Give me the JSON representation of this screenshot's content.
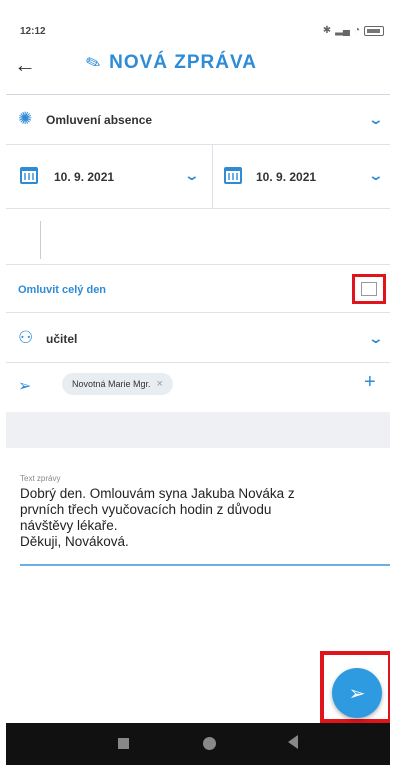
{
  "status": {
    "time": "12:12",
    "icons": [
      "bluetooth-icon",
      "signal-icon",
      "wifi-icon",
      "battery-icon"
    ]
  },
  "header": {
    "back_icon": "arrow-left-icon",
    "title_icon": "pencil-icon",
    "title": "NOVÁ ZPRÁVA"
  },
  "form": {
    "type": {
      "icon": "sun-icon",
      "value": "Omluvení absence"
    },
    "date_from": {
      "icon": "calendar-icon",
      "value": "10. 9. 2021"
    },
    "date_to": {
      "icon": "calendar-icon",
      "value": "10. 9. 2021"
    },
    "all_day": {
      "label": "Omluvit celý den",
      "checked": false
    },
    "recipient_type": {
      "icon": "user-icon",
      "value": "učitel"
    },
    "recipient": {
      "icon": "send-icon",
      "chip": "Novotná Marie Mgr.",
      "remove": "×",
      "add": "+"
    }
  },
  "message": {
    "label": "Text zprávy",
    "text": "Dobrý den. Omlouvám syna Jakuba Nováka z\nprvních třech vyučovacích hodin z důvodu\nnávštěvy lékaře.\nDěkuji, Nováková."
  },
  "fab": {
    "icon": "send-icon"
  },
  "colors": {
    "accent": "#2e8bd6",
    "highlight": "#e0151b"
  }
}
